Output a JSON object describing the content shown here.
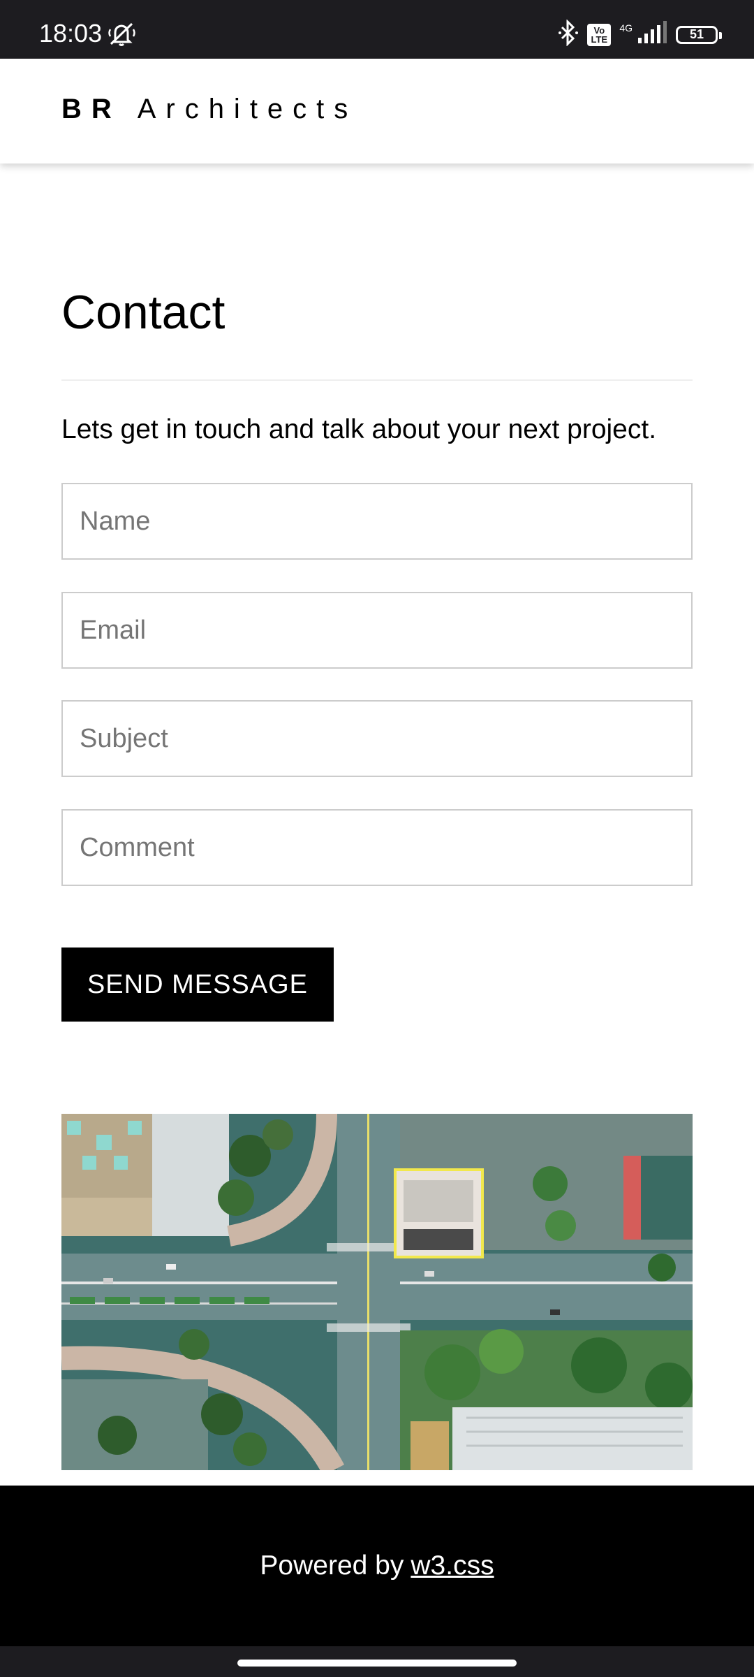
{
  "status_bar": {
    "time": "18:03",
    "battery": "51",
    "network": "4G",
    "volte": "Vo LTE",
    "icons": [
      "mute-icon",
      "bluetooth-icon",
      "volte-icon",
      "signal-icon",
      "battery-icon"
    ]
  },
  "header": {
    "brand_bold": "BR",
    "brand_rest": "Architects"
  },
  "contact": {
    "title": "Contact",
    "intro": "Lets get in touch and talk about your next project.",
    "fields": {
      "name_placeholder": "Name",
      "email_placeholder": "Email",
      "subject_placeholder": "Subject",
      "comment_placeholder": "Comment"
    },
    "send_label": "SEND MESSAGE"
  },
  "footer": {
    "text": "Powered by",
    "link": "w3.css"
  },
  "colors": {
    "status_bar": "#1d1c20",
    "button": "#000000",
    "footer": "#000000",
    "input_border": "#cccccc"
  }
}
